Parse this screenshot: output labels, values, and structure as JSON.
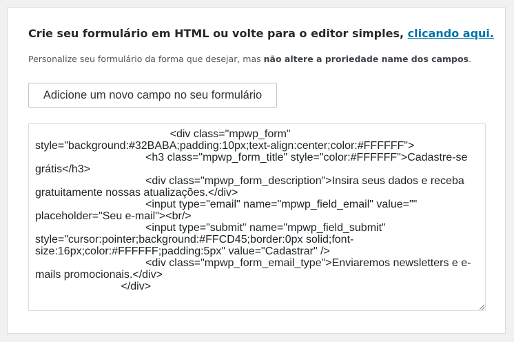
{
  "header": {
    "title": "Crie seu formulário em HTML ou volte para o editor simples, ",
    "link_label": "clicando aqui."
  },
  "description": {
    "text": "Personalize seu formulário da forma que desejar, mas ",
    "emphasis": "não altere a proriedade name dos campos",
    "end": "."
  },
  "add_field_button": {
    "label": "Adicione um novo campo no seu formulário"
  },
  "html_editor": {
    "value": "                                            <div class=\"mpwp_form\" style=\"background:#32BABA;padding:10px;text-align:center;color:#FFFFFF\">\n                                    <h3 class=\"mpwp_form_title\" style=\"color:#FFFFFF\">Cadastre-se grátis</h3>\n                                    <div class=\"mpwp_form_description\">Insira seus dados e receba gratuitamente nossas atualizações.</div>\n                                    <input type=\"email\" name=\"mpwp_field_email\" value=\"\" placeholder=\"Seu e-mail\"><br/>\n                                    <input type=\"submit\" name=\"mpwp_field_submit\" style=\"cursor:pointer;background:#FFCD45;border:0px solid;font-size:16px;color:#FFFFFF;padding:5px\" value=\"Cadastrar\" />\n                                    <div class=\"mpwp_form_email_type\">Enviaremos newsletters e e-mails promocionais.</div>\n                            </div>"
  },
  "colors": {
    "link": "#0073aa",
    "page_bg": "#f1f1f1",
    "panel_bg": "#ffffff"
  }
}
